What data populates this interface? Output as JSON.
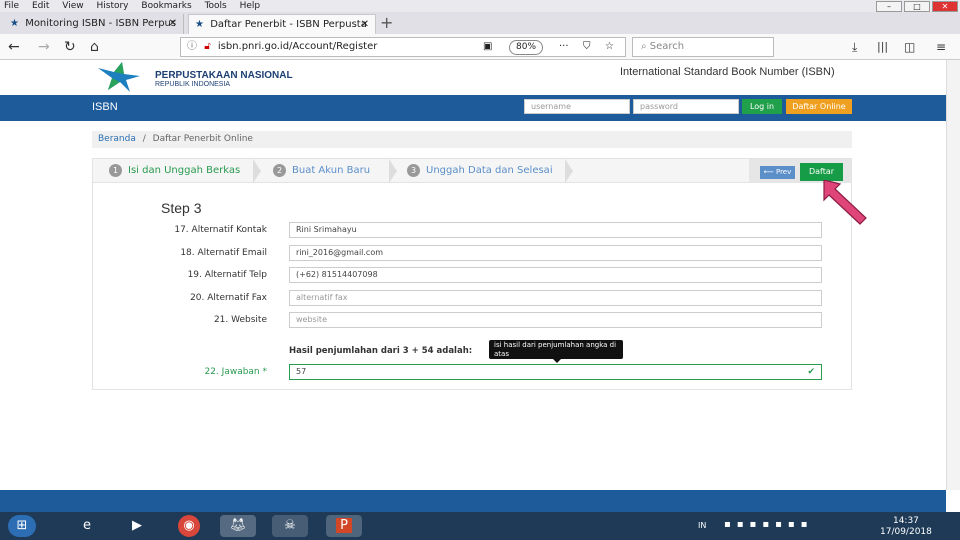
{
  "browser": {
    "menu": [
      "File",
      "Edit",
      "View",
      "History",
      "Bookmarks",
      "Tools",
      "Help"
    ],
    "tabs": [
      {
        "title": "Monitoring ISBN - ISBN Perpus"
      },
      {
        "title": "Daftar Penerbit - ISBN Perpusta"
      }
    ],
    "url": "isbn.pnri.go.id/Account/Register",
    "zoom": "80%",
    "search_placeholder": "Search",
    "window_controls": [
      "–",
      "□",
      "✕"
    ]
  },
  "site": {
    "org_name": "PERPUSTAKAAN NASIONAL",
    "org_sub": "REPUBLIK INDONESIA",
    "header_title": "International Standard Book Number (ISBN)",
    "brand": "ISBN",
    "username_placeholder": "username",
    "password_placeholder": "password",
    "login_label": "Log in",
    "register_label": "Daftar Online"
  },
  "breadcrumb": {
    "home": "Beranda",
    "separator": "/",
    "current": "Daftar Penerbit Online"
  },
  "wizard": {
    "steps": [
      {
        "num": "1",
        "label": "Isi dan Unggah Berkas"
      },
      {
        "num": "2",
        "label": "Buat Akun Baru"
      },
      {
        "num": "3",
        "label": "Unggah Data dan Selesai"
      }
    ],
    "prev_label": "Prev",
    "submit_label": "Daftar",
    "step_title": "Step 3",
    "fields": [
      {
        "label": "17. Alternatif Kontak",
        "value": "Rini Srimahayu",
        "placeholder": false
      },
      {
        "label": "18. Alternatif Email",
        "value": "rini_2016@gmail.com",
        "placeholder": false
      },
      {
        "label": "19. Alternatif Telp",
        "value": "(+62) 81514407098",
        "placeholder": false
      },
      {
        "label": "20. Alternatif Fax",
        "value": "alternatif fax",
        "placeholder": true
      },
      {
        "label": "21. Website",
        "value": "website",
        "placeholder": true
      }
    ],
    "question": "Hasil penjumlahan dari 3 + 54 adalah:",
    "tooltip": "isi hasil dari penjumlahan angka di atas",
    "answer_label": "22. Jawaban *",
    "answer_value": "57"
  },
  "taskbar": {
    "input_lang": "IN",
    "time": "14:37",
    "date": "17/09/2018"
  },
  "colors": {
    "nav_blue": "#1d5b9a",
    "green": "#169c46",
    "orange": "#f0a020",
    "annotation_arrow": "#e0457a"
  }
}
